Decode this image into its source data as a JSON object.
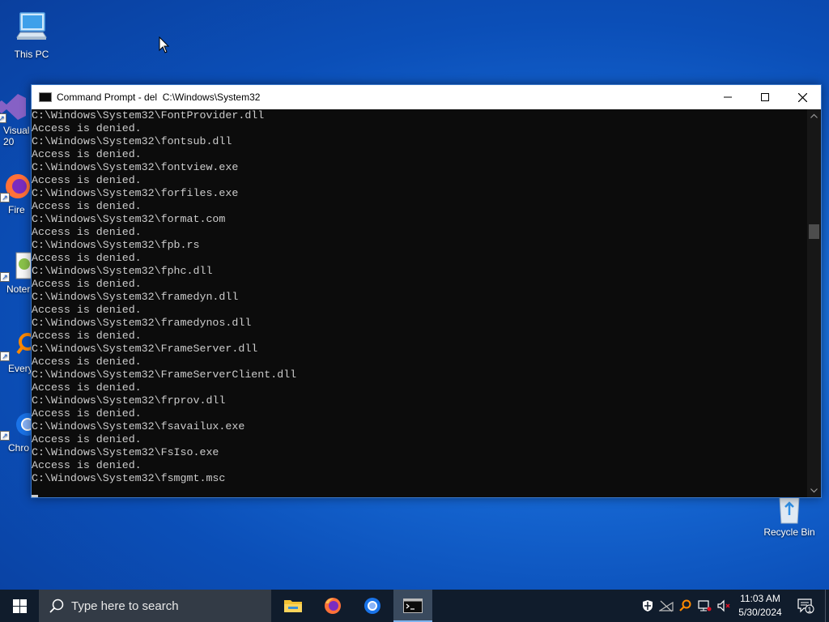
{
  "desktop": {
    "icons": [
      {
        "label": "This PC"
      },
      {
        "label": "Visual\n20"
      },
      {
        "label": "Fire"
      },
      {
        "label": "Noter"
      },
      {
        "label": "Every"
      },
      {
        "label": "Chro"
      },
      {
        "label": "Recycle Bin"
      }
    ]
  },
  "window": {
    "title": "Command Prompt - del  C:\\Windows\\System32"
  },
  "console": {
    "lines": [
      "C:\\Windows\\System32\\FontProvider.dll",
      "Access is denied.",
      "C:\\Windows\\System32\\fontsub.dll",
      "Access is denied.",
      "C:\\Windows\\System32\\fontview.exe",
      "Access is denied.",
      "C:\\Windows\\System32\\forfiles.exe",
      "Access is denied.",
      "C:\\Windows\\System32\\format.com",
      "Access is denied.",
      "C:\\Windows\\System32\\fpb.rs",
      "Access is denied.",
      "C:\\Windows\\System32\\fphc.dll",
      "Access is denied.",
      "C:\\Windows\\System32\\framedyn.dll",
      "Access is denied.",
      "C:\\Windows\\System32\\framedynos.dll",
      "Access is denied.",
      "C:\\Windows\\System32\\FrameServer.dll",
      "Access is denied.",
      "C:\\Windows\\System32\\FrameServerClient.dll",
      "Access is denied.",
      "C:\\Windows\\System32\\frprov.dll",
      "Access is denied.",
      "C:\\Windows\\System32\\fsavailux.exe",
      "Access is denied.",
      "C:\\Windows\\System32\\FsIso.exe",
      "Access is denied.",
      "C:\\Windows\\System32\\fsmgmt.msc"
    ]
  },
  "taskbar": {
    "search_placeholder": "Type here to search",
    "clock_time": "11:03 AM",
    "clock_date": "5/30/2024",
    "notification_count": "1"
  },
  "colors": {
    "console_bg": "#0c0c0c",
    "console_text": "#cccccc",
    "taskbar_bg": "#101c2c",
    "desktop_blue": "#1668d4"
  }
}
